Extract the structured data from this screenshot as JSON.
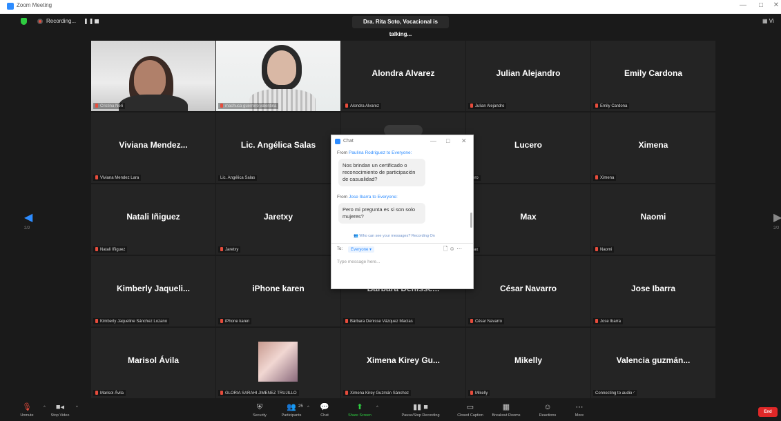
{
  "window": {
    "title": "Zoom Meeting",
    "min": "—",
    "max": "□"
  },
  "topbar": {
    "recording_label": "Recording...",
    "pause_icon": "pause-icon",
    "stop_icon": "stop-icon",
    "talking": "Dra. Rita Soto, Vocacional is talking...",
    "view_label": "Vi"
  },
  "grid": {
    "tiles": [
      {
        "name": "",
        "label": "Cristina Neri",
        "type": "video"
      },
      {
        "name": "",
        "label": "machuca guerrero valentina",
        "type": "video"
      },
      {
        "name": "Alondra Alvarez",
        "label": "Alondra Alvarez"
      },
      {
        "name": "Julian Alejandro",
        "label": "Julian Alejandro"
      },
      {
        "name": "Emily Cardona",
        "label": "Emily Cardona"
      },
      {
        "name": "Viviana Mendez...",
        "label": "Viviana Mendez Lara"
      },
      {
        "name": "Lic. Angélica Salas",
        "label": "Lic. Angélica Salas"
      },
      {
        "name": "",
        "label": ""
      },
      {
        "name": "Lucero",
        "label": "cero"
      },
      {
        "name": "Ximena",
        "label": "Ximena"
      },
      {
        "name": "Natali Iñiguez",
        "label": "Natali Iñiguez"
      },
      {
        "name": "Jaretxy",
        "label": "Jaretxy"
      },
      {
        "name": "",
        "label": ""
      },
      {
        "name": "Max",
        "label": "Max"
      },
      {
        "name": "Naomi",
        "label": "Naomi"
      },
      {
        "name": "Kimberly Jaqueli...",
        "label": "Kimberly Jaqueline Sánchez Lozano"
      },
      {
        "name": "iPhone karen",
        "label": "iPhone karen"
      },
      {
        "name": "Barbara Denisse...",
        "label": "Bárbara Denisse Vázquez Macías"
      },
      {
        "name": "César Navarro",
        "label": "César Navarro"
      },
      {
        "name": "Jose Ibarra",
        "label": "Jose Ibarra"
      },
      {
        "name": "Marisol Ávila",
        "label": "Marisol Ávila"
      },
      {
        "name": "",
        "label": "GLORIA SARAHI JIMENEZ TRUJILLO",
        "type": "photo"
      },
      {
        "name": "Ximena Kirey Gu...",
        "label": "Ximena Kirey Guzmán Sánchez"
      },
      {
        "name": "Mikelly",
        "label": "Mikelly"
      },
      {
        "name": "Valencia guzmán...",
        "label": "Connecting to audio"
      }
    ]
  },
  "nav": {
    "left_page": "2/2",
    "right_page": "2/2"
  },
  "chat": {
    "title": "Chat",
    "messages": [
      {
        "from_prefix": "From",
        "sender": "Paulina Rodriguez",
        "to": "to Everyone:",
        "text": "Nos brindan un certificado o reconocimiento de participación de casualidad?"
      },
      {
        "from_prefix": "From",
        "sender": "Jose Ibarra",
        "to": "to Everyone:",
        "text": "Pero mi pregunta es si son solo mujeres?"
      }
    ],
    "notice": "Who can see your messages? Recording On",
    "to_label": "To:",
    "to_value": "Everyone ▾",
    "placeholder": "Type message here..."
  },
  "toolbar": {
    "unmute": "Unmute",
    "stop_video": "Stop Video",
    "security": "Security",
    "participants": "Participants",
    "participants_count": "25",
    "chat": "Chat",
    "share_screen": "Share Screen",
    "pause_recording": "Pause/Stop Recording",
    "closed_caption": "Closed Caption",
    "breakout": "Breakout Rooms",
    "reactions": "Reactions",
    "more": "More",
    "end": "End"
  },
  "colors": {
    "accent": "#2d8cff",
    "end": "#e02828",
    "share": "#2ecc40",
    "muted": "#e74c3c"
  }
}
